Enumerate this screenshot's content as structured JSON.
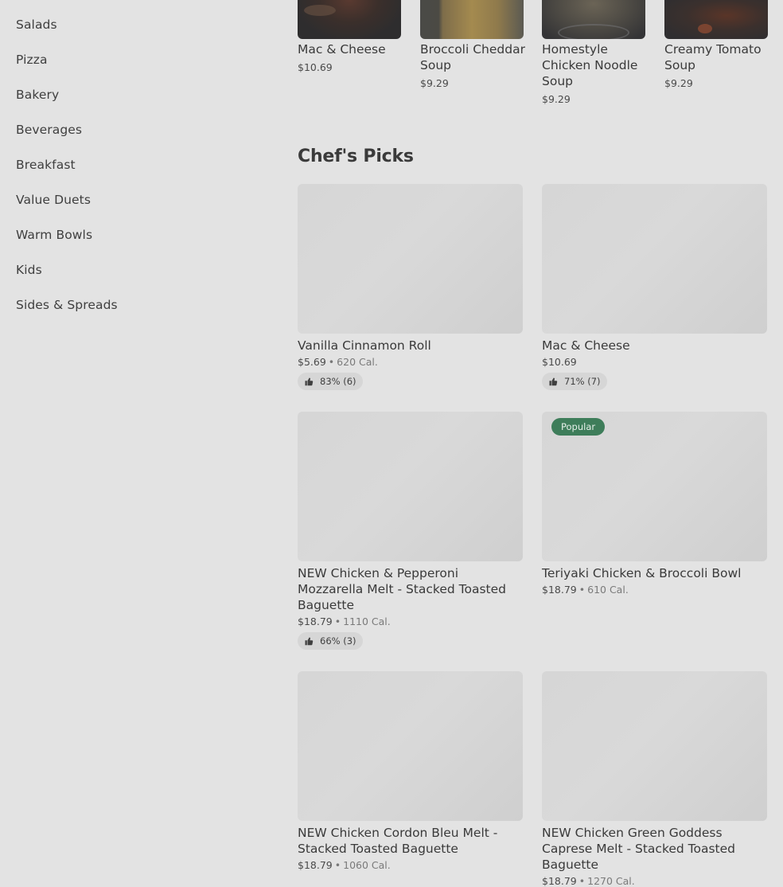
{
  "sidebar": {
    "items": [
      {
        "label": "Salads"
      },
      {
        "label": "Pizza"
      },
      {
        "label": "Bakery"
      },
      {
        "label": "Beverages"
      },
      {
        "label": "Breakfast"
      },
      {
        "label": "Value Duets"
      },
      {
        "label": "Warm Bowls"
      },
      {
        "label": "Kids"
      },
      {
        "label": "Sides & Spreads"
      }
    ]
  },
  "top_row": {
    "items": [
      {
        "name": "Mac & Cheese",
        "price": "$10.69"
      },
      {
        "name": "Broccoli Cheddar Soup",
        "price": "$9.29"
      },
      {
        "name": "Homestyle Chicken Noodle Soup",
        "price": "$9.29"
      },
      {
        "name": "Creamy Tomato Soup",
        "price": "$9.29"
      }
    ]
  },
  "chefs_picks": {
    "title": "Chef's Picks",
    "items": [
      {
        "name": "Vanilla Cinnamon Roll",
        "price": "$5.69",
        "separator": "•",
        "calories": "620 Cal.",
        "rating": "83% (6)"
      },
      {
        "name": "Mac & Cheese",
        "price": "$10.69",
        "rating": "71% (7)"
      },
      {
        "name": "NEW Chicken & Pepperoni Mozzarella Melt - Stacked Toasted Baguette",
        "price": "$18.79",
        "separator": "•",
        "calories": "1110 Cal.",
        "rating": "66% (3)"
      },
      {
        "name": "Teriyaki Chicken & Broccoli Bowl",
        "price": "$18.79",
        "separator": "•",
        "calories": "610 Cal.",
        "badge": "Popular"
      },
      {
        "name": "NEW Chicken Cordon Bleu Melt - Stacked Toasted Baguette",
        "price": "$18.79",
        "separator": "•",
        "calories": "1060 Cal."
      },
      {
        "name": "NEW Chicken Green Goddess Caprese Melt - Stacked Toasted Baguette",
        "price": "$18.79",
        "separator": "•",
        "calories": "1270 Cal."
      }
    ]
  },
  "colors": {
    "background": "#e3e3e3",
    "badge": "#3e7d5a",
    "rating_pill": "#d6d6d6",
    "image_placeholder": "#d6d6d6"
  },
  "icons": {
    "rating": "thumbs-up-icon"
  }
}
